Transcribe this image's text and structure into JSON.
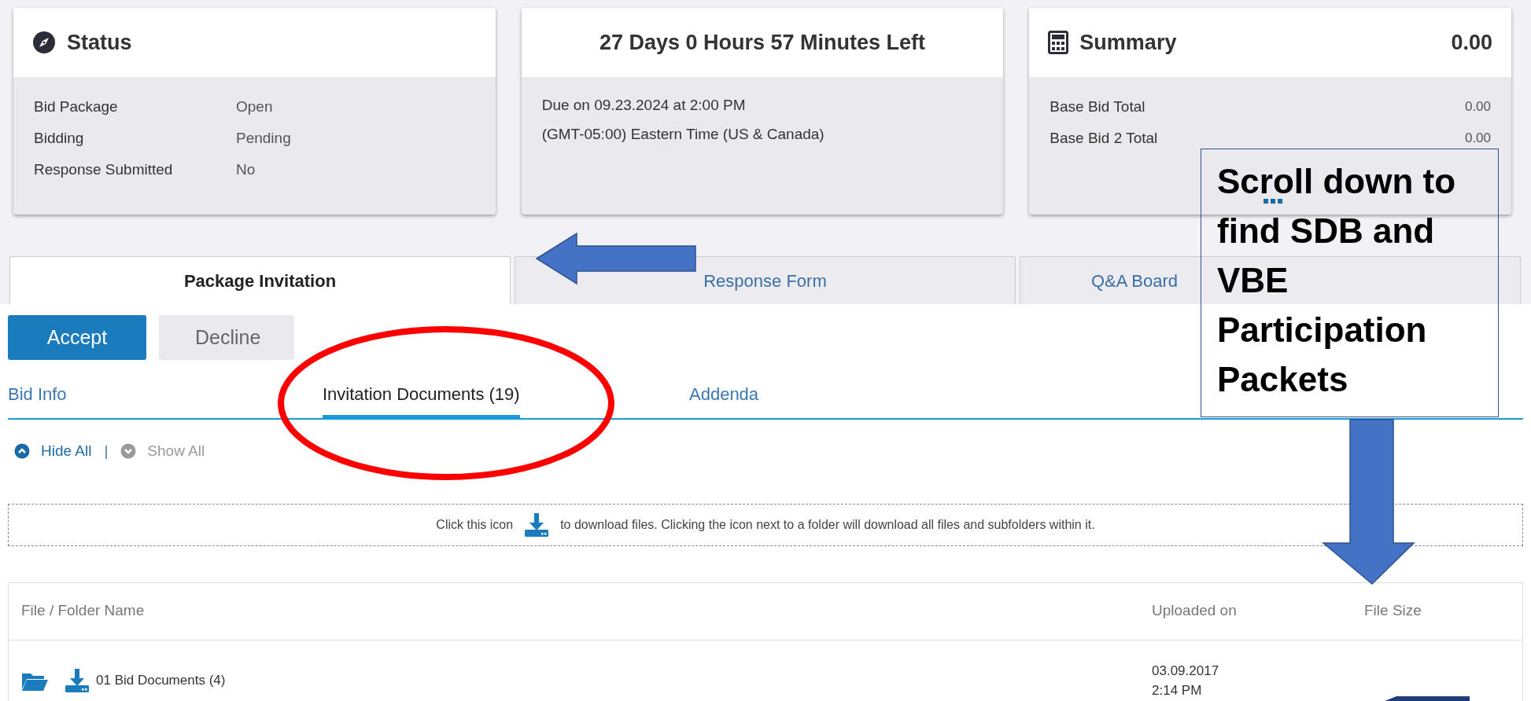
{
  "status_card": {
    "title": "Status",
    "rows": [
      {
        "label": "Bid Package",
        "value": "Open"
      },
      {
        "label": "Bidding",
        "value": "Pending"
      },
      {
        "label": "Response Submitted",
        "value": "No"
      }
    ]
  },
  "countdown_card": {
    "title": "27 Days 0 Hours 57 Minutes Left",
    "lines": [
      "Due on 09.23.2024 at 2:00 PM",
      "(GMT-05:00) Eastern Time (US & Canada)"
    ]
  },
  "summary_card": {
    "title": "Summary",
    "total": "0.00",
    "rows": [
      {
        "label": "Base Bid Total",
        "value": "0.00"
      },
      {
        "label": "Base Bid 2 Total",
        "value": "0.00"
      }
    ]
  },
  "main_tabs": [
    {
      "label": "Package Invitation",
      "selected": true
    },
    {
      "label": "Response Form",
      "selected": false
    },
    {
      "label": "Q&A Board",
      "selected": false
    }
  ],
  "actions": [
    {
      "label": "Accept",
      "kind": "primary"
    },
    {
      "label": "Decline",
      "kind": "secondary"
    }
  ],
  "sub_tabs": [
    {
      "label": "Bid Info",
      "selected": false
    },
    {
      "label": "Invitation Documents (19)",
      "selected": true
    },
    {
      "label": "Addenda",
      "selected": false
    }
  ],
  "toggles": [
    {
      "label": "Hide All",
      "kind": "collapse",
      "disabled": false
    },
    {
      "label": "Show All",
      "kind": "expand",
      "disabled": true
    }
  ],
  "toggle_separator": "|",
  "hint": {
    "before": "Click this icon",
    "after": "to download files. Clicking the icon next to a folder will download all files and subfolders within it."
  },
  "table": {
    "columns": [
      "File / Folder Name",
      "Uploaded on",
      "File Size"
    ],
    "rows": [
      {
        "kind": "folder",
        "name": "01 Bid Documents (4)",
        "uploaded": [
          "03.09.2017",
          "2:14 PM"
        ]
      }
    ]
  },
  "callout": {
    "text": "Scroll down to find SDB and VBE Participation Packets"
  }
}
